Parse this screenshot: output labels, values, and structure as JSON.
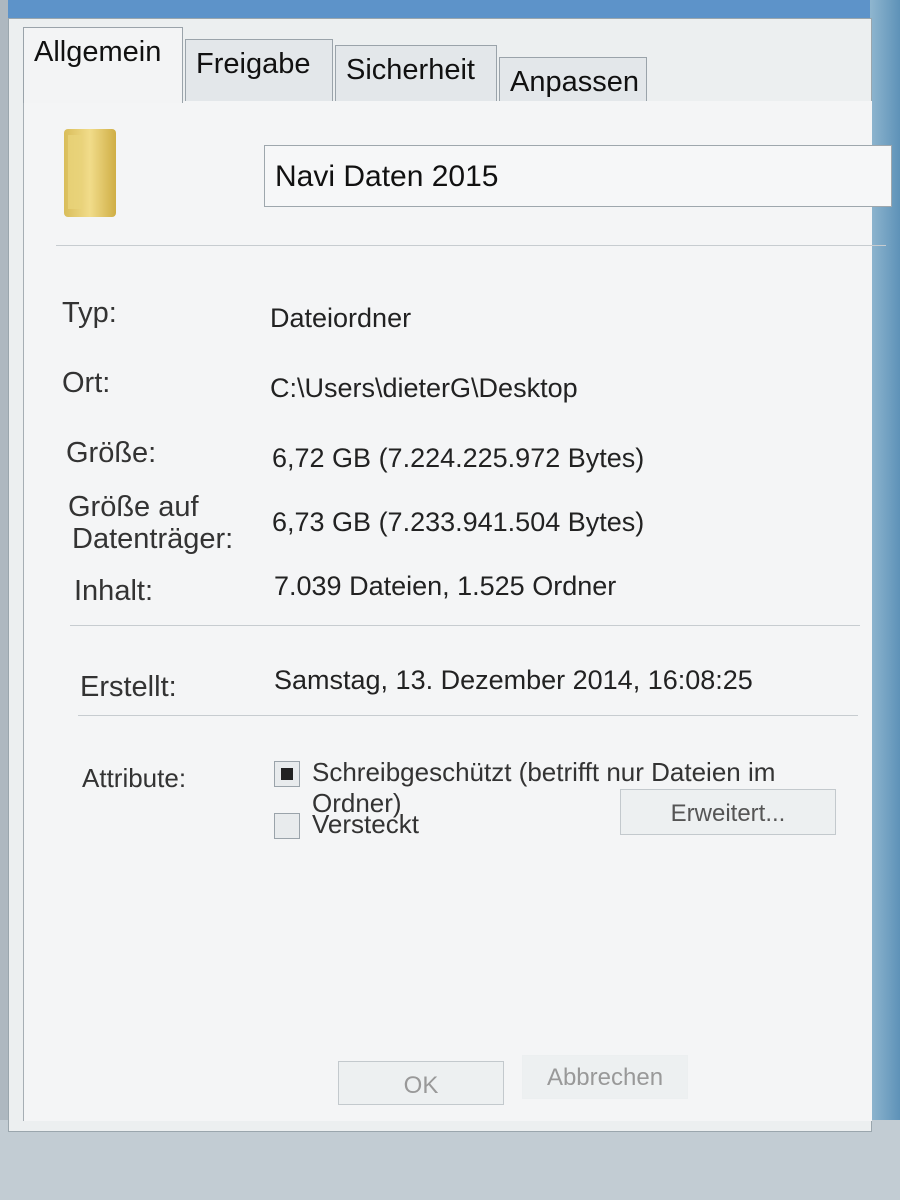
{
  "tabs": [
    {
      "label": "Allgemein"
    },
    {
      "label": "Freigabe"
    },
    {
      "label": "Sicherheit"
    },
    {
      "label": "Anpassen"
    }
  ],
  "folder": {
    "icon": "folder-icon",
    "name": "Navi Daten 2015"
  },
  "properties": {
    "type_label": "Typ:",
    "type_value": "Dateiordner",
    "location_label": "Ort:",
    "location_value": "C:\\Users\\dieterG\\Desktop",
    "size_label": "Größe:",
    "size_value": "6,72 GB (7.224.225.972 Bytes)",
    "size_on_disk_label_line1": "Größe auf",
    "size_on_disk_label_line2": "Datenträger:",
    "size_on_disk_value": "6,73 GB (7.233.941.504 Bytes)",
    "contents_label": "Inhalt:",
    "contents_value": "7.039 Dateien, 1.525 Ordner",
    "created_label": "Erstellt:",
    "created_value": "Samstag, 13. Dezember 2014, 16:08:25"
  },
  "attributes": {
    "label": "Attribute:",
    "readonly_label": "Schreibgeschützt (betrifft nur Dateien im Ordner)",
    "readonly_state": "indeterminate",
    "hidden_label": "Versteckt",
    "hidden_state": "unchecked",
    "advanced_button": "Erweitert..."
  },
  "buttons": {
    "ok": "OK",
    "cancel": "Abbrechen"
  },
  "colors": {
    "taskbar_blue": "#5d93c9",
    "dialog_bg": "#eceff0",
    "panel_bg": "#f4f5f6"
  }
}
